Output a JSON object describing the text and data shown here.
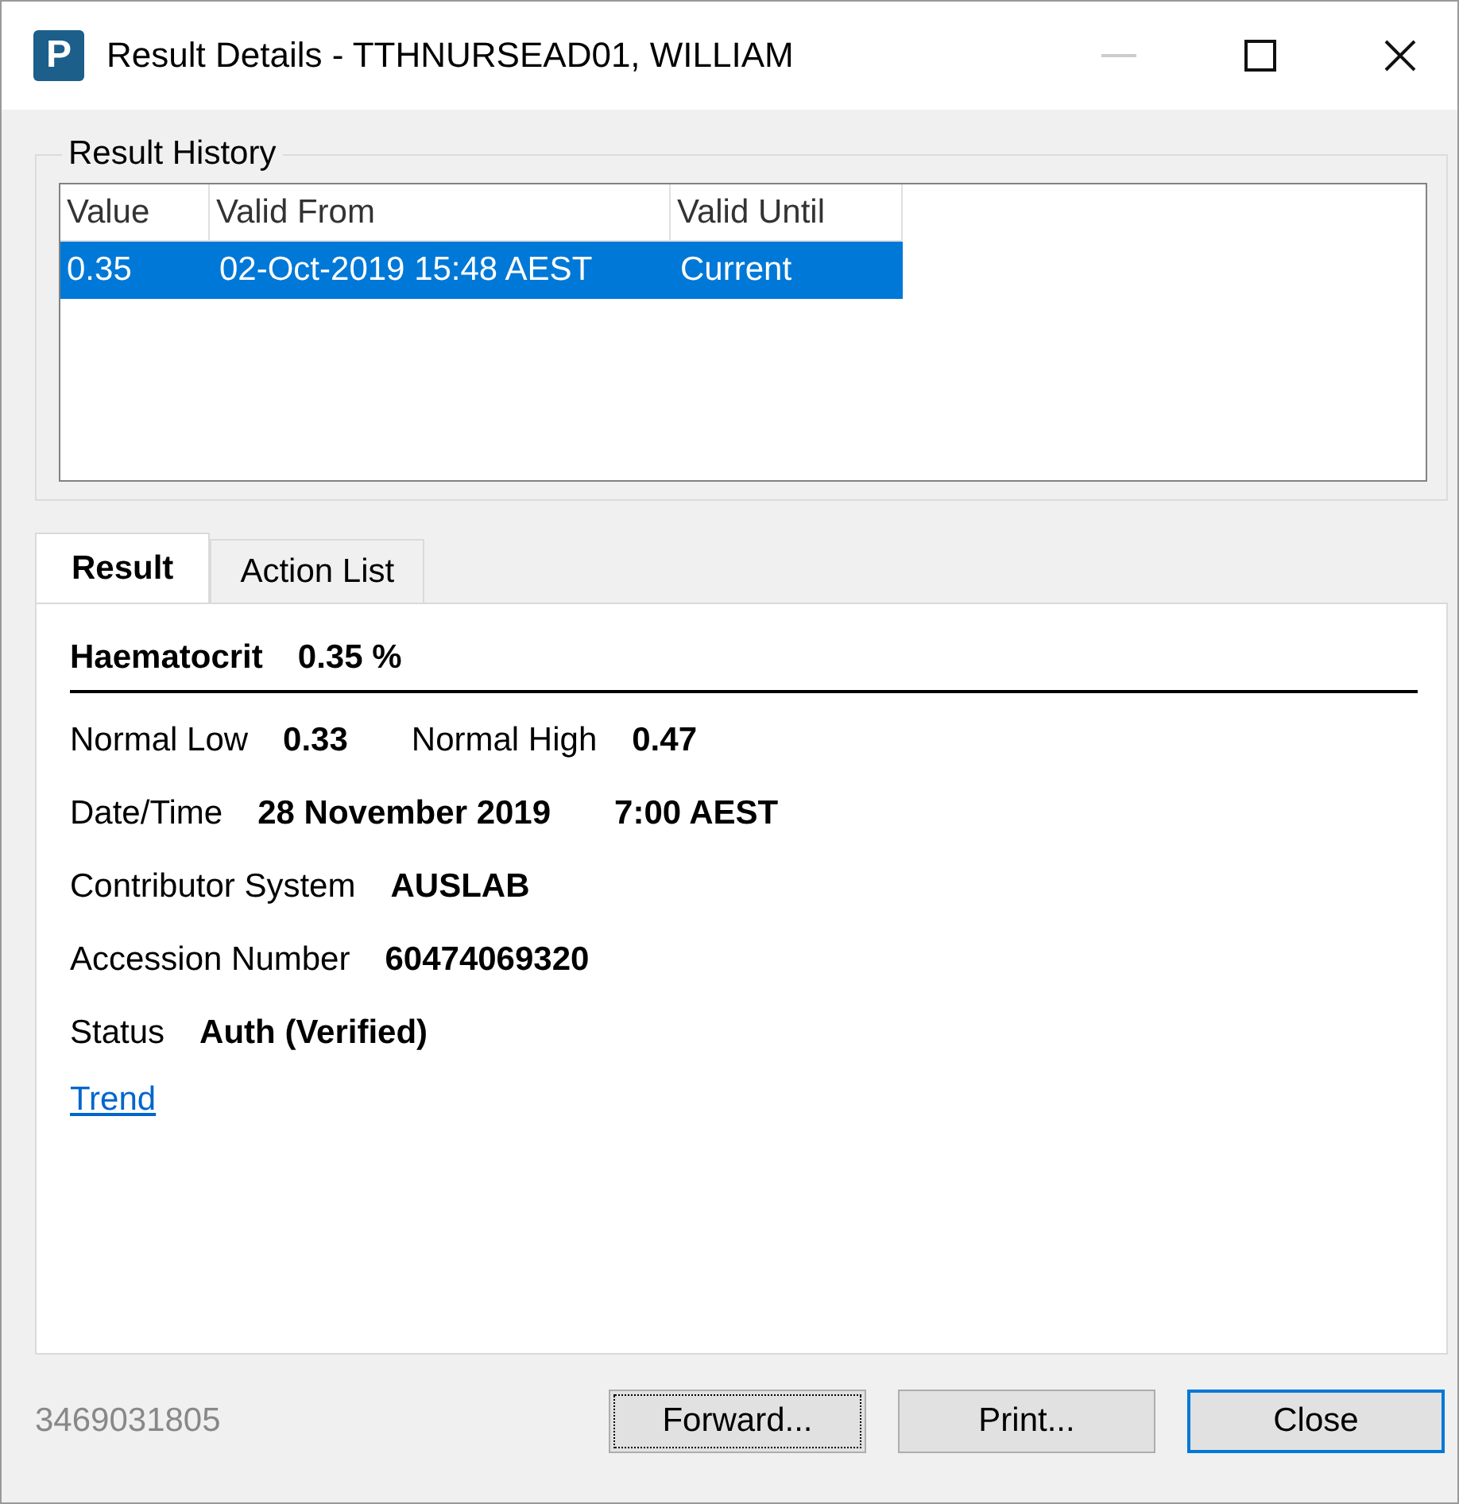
{
  "window": {
    "title": "Result Details - TTHNURSEAD01, WILLIAM",
    "app_icon_letter": "P",
    "minimize_disabled": true
  },
  "result_history": {
    "title": "Result History",
    "columns": [
      "Value",
      "Valid From",
      "Valid Until"
    ],
    "rows": [
      {
        "cells": [
          "0.35",
          "02-Oct-2019 15:48 AEST",
          "Current"
        ],
        "selected": true
      }
    ]
  },
  "tabs": [
    {
      "label": "Result",
      "selected": true
    },
    {
      "label": "Action List",
      "selected": false
    }
  ],
  "result": {
    "name": "Haematocrit",
    "value": "0.35 %",
    "lines": [
      {
        "parts": [
          {
            "kind": "label",
            "text": "Normal Low"
          },
          {
            "kind": "value",
            "text": "0.33"
          },
          {
            "kind": "label",
            "text": "Normal High"
          },
          {
            "kind": "value",
            "text": "0.47"
          }
        ]
      },
      {
        "parts": [
          {
            "kind": "label",
            "text": "Date/Time"
          },
          {
            "kind": "value",
            "text": "28 November 2019"
          },
          {
            "kind": "value",
            "text": "7:00 AEST"
          }
        ]
      },
      {
        "parts": [
          {
            "kind": "label",
            "text": "Contributor System"
          },
          {
            "kind": "value",
            "text": "AUSLAB"
          }
        ]
      },
      {
        "parts": [
          {
            "kind": "label",
            "text": "Accession Number"
          },
          {
            "kind": "value",
            "text": "60474069320"
          }
        ]
      },
      {
        "parts": [
          {
            "kind": "label",
            "text": "Status"
          },
          {
            "kind": "value",
            "text": "Auth (Verified)"
          }
        ]
      }
    ],
    "link": "Trend"
  },
  "footer": {
    "id": "3469031805",
    "buttons": [
      {
        "label": "Forward...",
        "focused": true,
        "default": false
      },
      {
        "label": "Print...",
        "focused": false,
        "default": false
      },
      {
        "label": "Close",
        "focused": false,
        "default": true
      }
    ]
  }
}
